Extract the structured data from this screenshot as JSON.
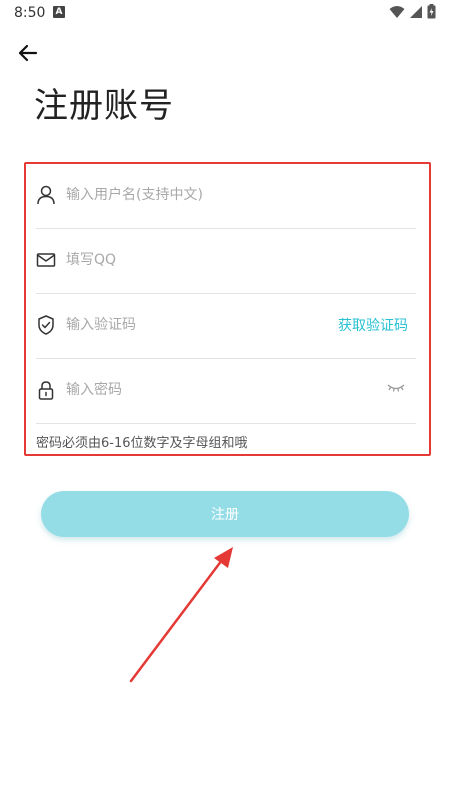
{
  "status_bar": {
    "time": "8:50",
    "notif_icon_letter": "A"
  },
  "page": {
    "title": "注册账号"
  },
  "form": {
    "username_placeholder": "输入用户名(支持中文)",
    "qq_placeholder": "填写QQ",
    "code_placeholder": "输入验证码",
    "get_code_label": "获取验证码",
    "password_placeholder": "输入密码",
    "password_hint": "密码必须由6-16位数字及字母组和哦"
  },
  "actions": {
    "register_label": "注册"
  },
  "colors": {
    "accent": "#26c0d3",
    "button_bg": "#95dde6",
    "highlight_border": "#e53935",
    "arrow": "#e53935"
  }
}
